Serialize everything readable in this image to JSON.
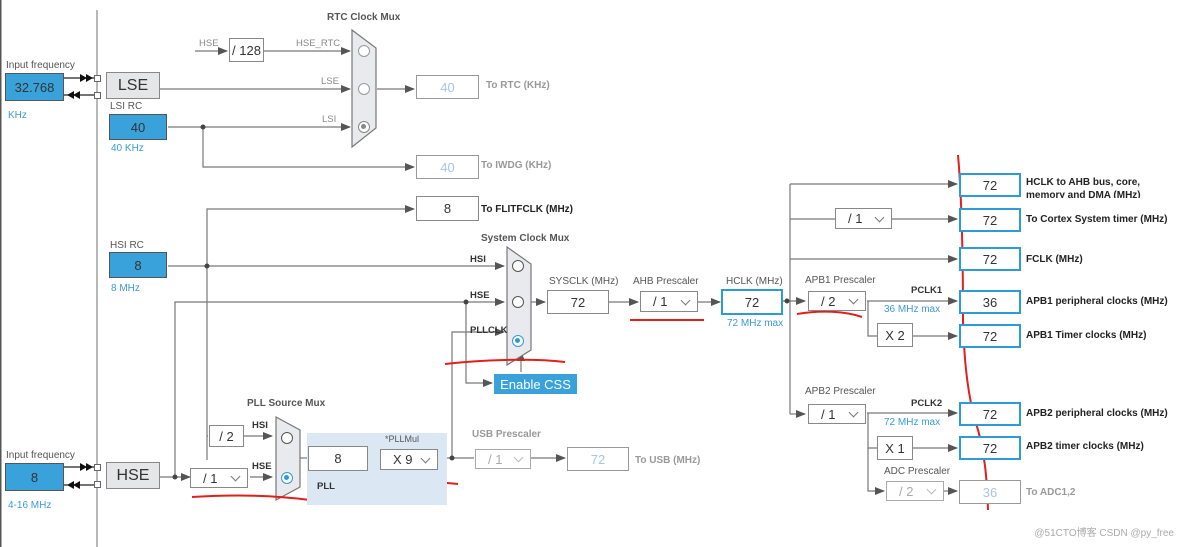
{
  "left_panel": {
    "lse_input": {
      "label": "Input frequency",
      "value": "32.768",
      "unit": "KHz"
    },
    "hse_input": {
      "label": "Input frequency",
      "value": "8",
      "unit": "4-16 MHz"
    }
  },
  "oscillators": {
    "lse": "LSE",
    "hse": "HSE",
    "lsi": {
      "title": "LSI RC",
      "value": "40",
      "freq": "40 KHz"
    },
    "hsi": {
      "title": "HSI RC",
      "value": "8",
      "freq": "8 MHz"
    }
  },
  "rtc": {
    "mux_title": "RTC Clock Mux",
    "hse_label": "HSE",
    "div128": "/ 128",
    "hse_rtc_label": "HSE_RTC",
    "lse_label": "LSE",
    "lsi_label": "LSI",
    "selected": "LSI",
    "rtc_value": "40",
    "rtc_out": "To RTC (KHz)",
    "iwdg_value": "40",
    "iwdg_out": "To IWDG (KHz)"
  },
  "flitf": {
    "value": "8",
    "label": "To FLITFCLK (MHz)"
  },
  "system_mux": {
    "title": "System Clock Mux",
    "inputs": [
      "HSI",
      "HSE",
      "PLLCLK"
    ],
    "selected": "PLLCLK",
    "css_button": "Enable CSS"
  },
  "sysclk": {
    "label": "SYSCLK (MHz)",
    "value": "72"
  },
  "ahb": {
    "label": "AHB Prescaler",
    "value": "/ 1"
  },
  "hclk": {
    "label": "HCLK (MHz)",
    "value": "72",
    "max": "72 MHz max"
  },
  "pll_source": {
    "title": "PLL Source Mux",
    "hsi_div": "/ 2",
    "hsi_label": "HSI",
    "hse_label": "HSE",
    "hse_prediv": "/ 1",
    "selected": "HSE"
  },
  "pll": {
    "label": "PLL",
    "input_value": "8",
    "mul_label": "*PLLMul",
    "mul_value": "X 9"
  },
  "usb": {
    "label": "USB Prescaler",
    "prescaler": "/ 1",
    "value": "72",
    "out": "To USB (MHz)"
  },
  "outputs": {
    "ahb_bus": {
      "value": "72",
      "label": "HCLK to AHB bus, core, memory and DMA (MHz)"
    },
    "cortex_div": "/ 1",
    "cortex": {
      "value": "72",
      "label": "To Cortex System timer (MHz)"
    },
    "fclk": {
      "value": "72",
      "label": "FCLK (MHz)"
    }
  },
  "apb1": {
    "label": "APB1 Prescaler",
    "prescaler": "/ 2",
    "pclk": "PCLK1",
    "max": "36 MHz max",
    "periph": {
      "value": "36",
      "label": "APB1 peripheral clocks (MHz)"
    },
    "timer_mul": "X 2",
    "timer": {
      "value": "72",
      "label": "APB1 Timer clocks (MHz)"
    }
  },
  "apb2": {
    "label": "APB2 Prescaler",
    "prescaler": "/ 1",
    "pclk": "PCLK2",
    "max": "72 MHz max",
    "periph": {
      "value": "72",
      "label": "APB2 peripheral clocks (MHz)"
    },
    "timer_mul": "X 1",
    "timer": {
      "value": "72",
      "label": "APB2 timer clocks (MHz)"
    },
    "adc_label": "ADC Prescaler",
    "adc_prescaler": "/ 2",
    "adc": {
      "value": "36",
      "label": "To ADC1,2"
    }
  },
  "annotation_color": "#e0201c",
  "accent_color": "#3aa2db",
  "watermark": "@51CTO博客 CSDN @py_free"
}
